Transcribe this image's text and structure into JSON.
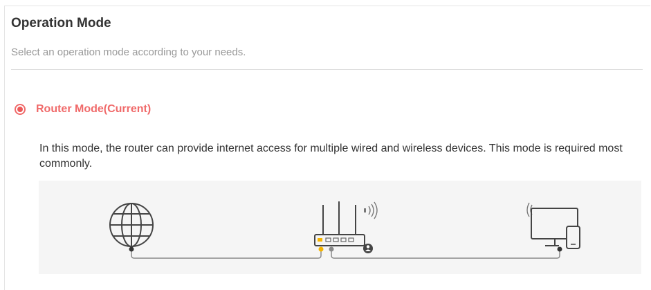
{
  "header": {
    "title": "Operation Mode",
    "subtitle": "Select an operation mode according to your needs."
  },
  "mode": {
    "label": "Router Mode(Current)",
    "selected": true,
    "description": "In this mode, the router can provide internet access for multiple wired and wireless devices. This mode is required most commonly."
  },
  "diagram": {
    "icons": [
      "globe-icon",
      "router-icon",
      "wifi-signal-icon",
      "monitor-icon",
      "phone-icon"
    ]
  },
  "colors": {
    "accent": "#f06a6a",
    "title": "#333333",
    "subtitle": "#999999",
    "diagram_bg": "#f5f5f5",
    "port_highlight": "#f5b400"
  }
}
